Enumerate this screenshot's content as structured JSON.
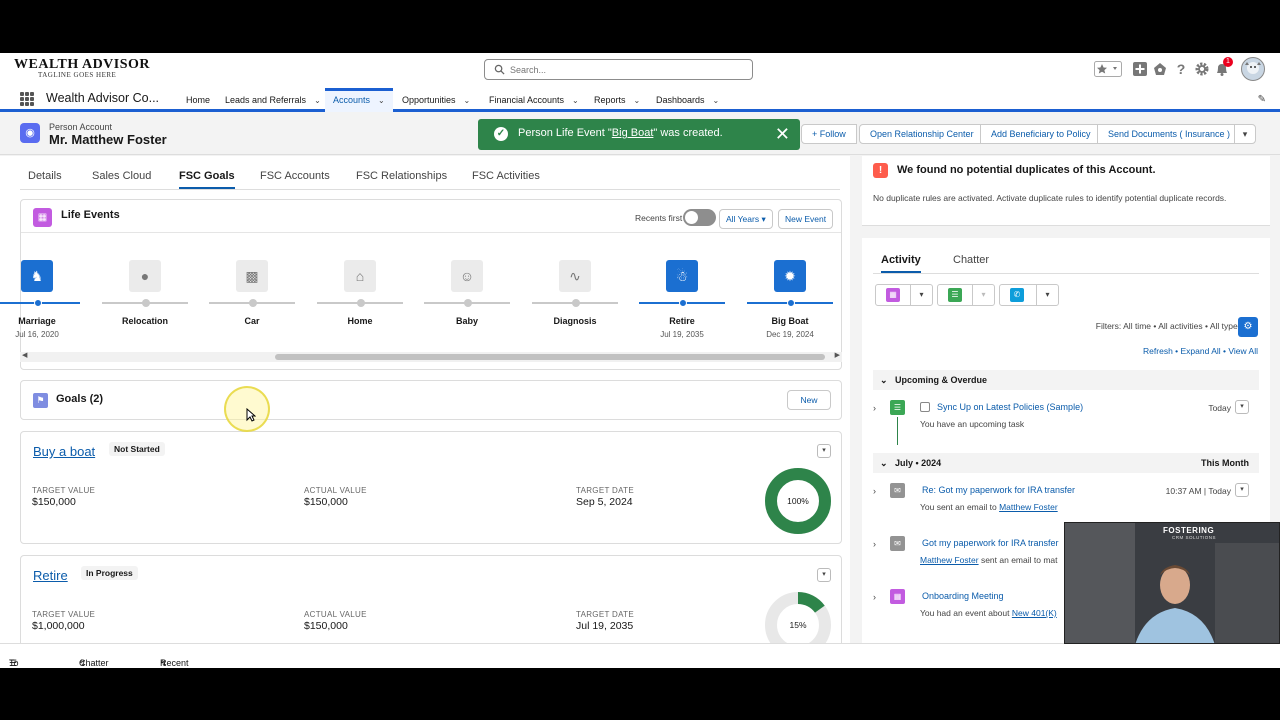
{
  "brand": {
    "name": "WEALTH ADVISOR",
    "tagline": "TAGLINE GOES HERE"
  },
  "search": {
    "placeholder": "Search..."
  },
  "notifications": {
    "count": "1"
  },
  "nav": {
    "app_name": "Wealth Advisor Co...",
    "items": [
      {
        "label": "Home"
      },
      {
        "label": "Leads and Referrals"
      },
      {
        "label": "Accounts"
      },
      {
        "label": "Opportunities"
      },
      {
        "label": "Financial Accounts"
      },
      {
        "label": "Reports"
      },
      {
        "label": "Dashboards"
      }
    ]
  },
  "record": {
    "type": "Person Account",
    "name": "Mr. Matthew Foster"
  },
  "toast": {
    "prefix": "Person Life Event \"",
    "link": "Big Boat",
    "suffix": "\" was created."
  },
  "actions": {
    "follow": "Follow",
    "open_rel": "Open Relationship Center",
    "add_ben": "Add Beneficiary to Policy",
    "send_docs": "Send Documents ( Insurance )"
  },
  "tabs": [
    "Details",
    "Sales Cloud",
    "FSC Goals",
    "FSC Accounts",
    "FSC Relationships",
    "FSC Activities"
  ],
  "life_events": {
    "title": "Life Events",
    "recents": "Recents first",
    "filter": "All Years",
    "new_btn": "New Event",
    "events": [
      {
        "name": "Marriage",
        "date": "Jul 16, 2020"
      },
      {
        "name": "Relocation",
        "date": ""
      },
      {
        "name": "Car",
        "date": ""
      },
      {
        "name": "Home",
        "date": ""
      },
      {
        "name": "Baby",
        "date": ""
      },
      {
        "name": "Diagnosis",
        "date": ""
      },
      {
        "name": "Retire",
        "date": "Jul 19, 2035"
      },
      {
        "name": "Big Boat",
        "date": "Dec 19, 2024"
      }
    ]
  },
  "goals": {
    "title": "Goals (2)",
    "new_btn": "New",
    "labels": {
      "target_value": "TARGET VALUE",
      "actual_value": "ACTUAL VALUE",
      "target_date": "TARGET DATE"
    },
    "items": [
      {
        "name": "Buy a boat",
        "status": "Not Started",
        "target_value": "$150,000",
        "actual_value": "$150,000",
        "target_date": "Sep 5, 2024",
        "progress": "100%",
        "color": "#2e844a"
      },
      {
        "name": "Retire",
        "status": "In Progress",
        "target_value": "$1,000,000",
        "actual_value": "$150,000",
        "target_date": "Jul 19, 2035",
        "progress": "15%",
        "color": "#2e844a"
      }
    ]
  },
  "duplicates": {
    "title": "We found no potential duplicates of this Account.",
    "subtitle": "No duplicate rules are activated. Activate duplicate rules to identify potential duplicate records."
  },
  "activity": {
    "tabs": [
      "Activity",
      "Chatter"
    ],
    "filters": "Filters: All time • All activities • All types",
    "refresh": "Refresh",
    "expand_all": "Expand All",
    "view_all": "View All",
    "upcoming": "Upcoming & Overdue",
    "month_header": "July • 2024",
    "month_tag": "This Month",
    "items": [
      {
        "title": "Sync Up on Latest Policies (Sample)",
        "sub": "You have an upcoming task",
        "time": "Today"
      },
      {
        "title": "Re: Got my paperwork for IRA transfer",
        "sub_prefix": "You sent an email to",
        "sub_link": "Matthew Foster",
        "time": "10:37 AM | Today"
      },
      {
        "title": "Got my paperwork for IRA transfer",
        "sub_link": "Matthew Foster",
        "sub_suffix": "sent an email to mat"
      },
      {
        "title": "Onboarding Meeting",
        "sub_prefix": "You had an event about",
        "sub_link": "New 401(K)"
      }
    ]
  },
  "footer": {
    "todo": "To Do List",
    "chatter": "Chatter Feed",
    "recent": "Recent Items"
  },
  "webcam": {
    "brand": "FOSTERING",
    "brand_sub": "CRM SOLUTIONS"
  }
}
